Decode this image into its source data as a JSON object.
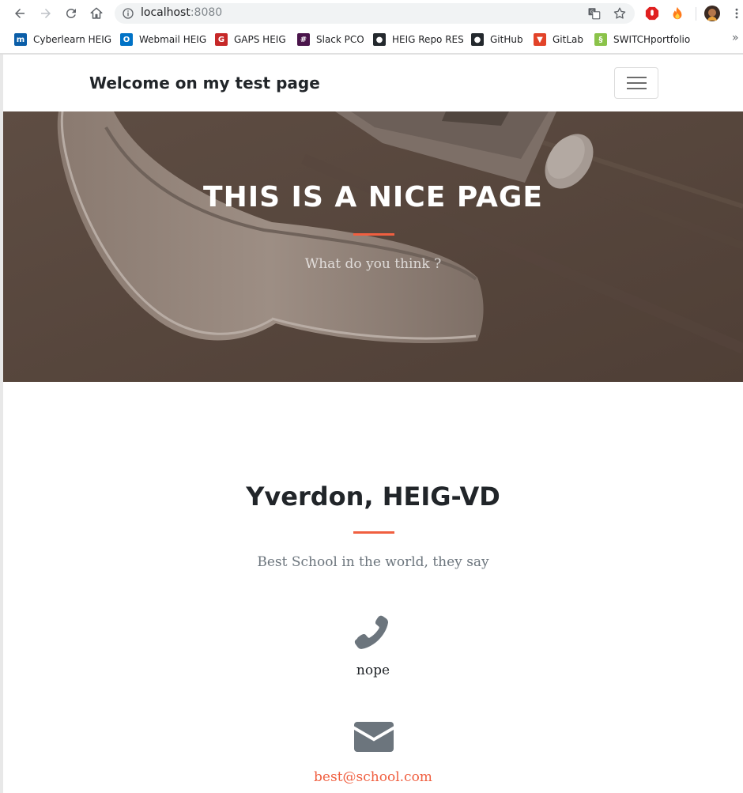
{
  "browser": {
    "url_host": "localhost",
    "url_port": ":8080",
    "bookmarks": [
      {
        "label": "Cyberlearn HEIG",
        "color": "#0b5ea8",
        "glyph": "m"
      },
      {
        "label": "Webmail HEIG",
        "color": "#0072c6",
        "glyph": "O"
      },
      {
        "label": "GAPS HEIG",
        "color": "#c62828",
        "glyph": "G"
      },
      {
        "label": "Slack PCO",
        "color": "#4a154b",
        "glyph": "#"
      },
      {
        "label": "HEIG Repo RES",
        "color": "#24292e",
        "glyph": "●"
      },
      {
        "label": "GitHub",
        "color": "#24292e",
        "glyph": "●"
      },
      {
        "label": "GitLab",
        "color": "#e24329",
        "glyph": "▼"
      },
      {
        "label": "SWITCHportfolio",
        "color": "#8bc34a",
        "glyph": "§"
      }
    ],
    "more_label": "»"
  },
  "navbar": {
    "brand": "Welcome on my test page"
  },
  "hero": {
    "title": "THIS IS A NICE PAGE",
    "subtitle": "What do you think ?"
  },
  "contact": {
    "title": "Yverdon, HEIG-VD",
    "subtitle": "Best School in the world, they say",
    "phone": "nope",
    "email": "best@school.com"
  },
  "colors": {
    "accent": "#f05f40",
    "icon": "#6c757d"
  }
}
